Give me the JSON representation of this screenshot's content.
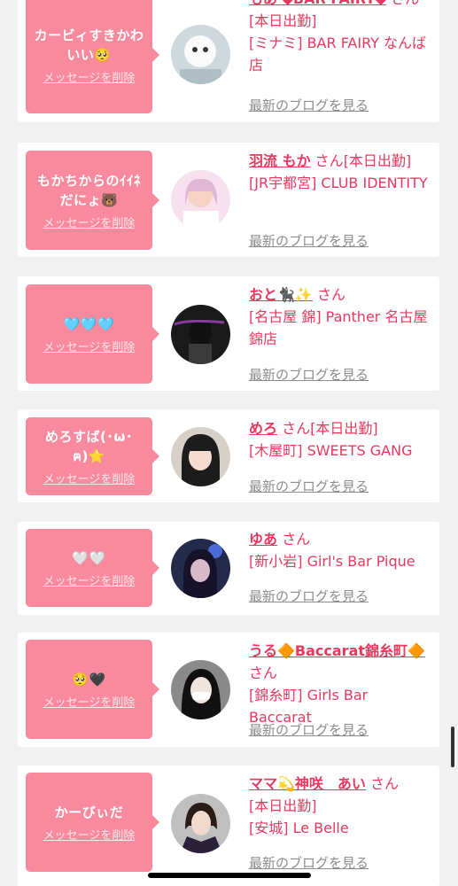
{
  "delete_label": "メッセージを削除",
  "blog_label": "最新のブログを見る",
  "san_label": "さん",
  "cards": [
    {
      "message": "カービィすきかわいい🥺",
      "name": "もあ ◆BAR FAIRY◆",
      "status": "[本日出勤]",
      "shop": "[ミナミ] BAR FAIRY なんば店"
    },
    {
      "message": "もかちからのｲｲﾈだにょ🐻",
      "name": "羽流 もか",
      "status": "[本日出勤]",
      "shop": "[JR宇都宮] CLUB IDENTITY"
    },
    {
      "message": "🩵🩵🩵",
      "name": "おと🐈‍⬛✨",
      "status": "",
      "shop": "[名古屋 錦] Panther 名古屋錦店"
    },
    {
      "message": "めろすば(･ω･ฅ)⭐",
      "name": "めろ",
      "status": "[本日出勤]",
      "shop": "[木屋町] SWEETS GANG"
    },
    {
      "message": "🤍🤍",
      "name": "ゆあ",
      "status": "",
      "shop": "[新小岩] Girl's Bar Pique"
    },
    {
      "message": "🥺🖤",
      "name": "うる🔶Baccarat錦糸町🔶",
      "status": "",
      "shop": "[錦糸町] Girls Bar Baccarat"
    },
    {
      "message": "かーびぃだ",
      "name": "ママ💫神咲　あい",
      "status": "[本日出勤]",
      "shop": "[安城] Le Belle"
    }
  ]
}
